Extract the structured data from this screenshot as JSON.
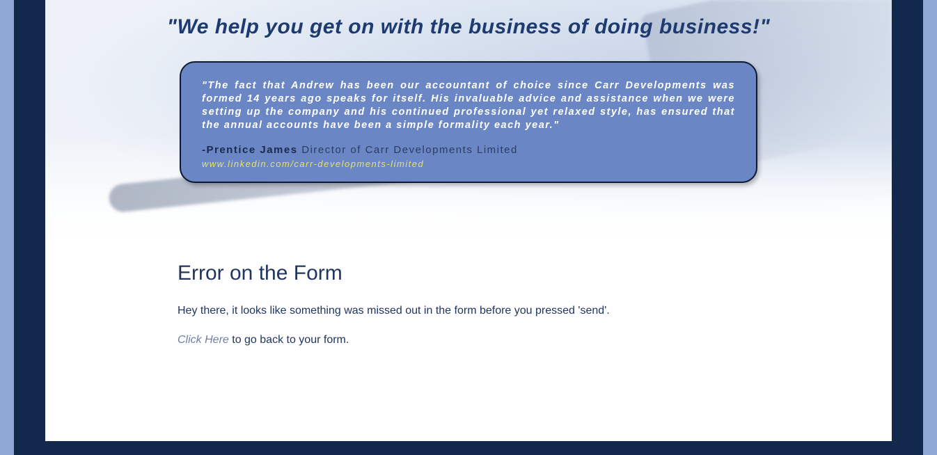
{
  "hero": {
    "tagline": "\"We help you get on with the business of doing business!\""
  },
  "testimonial": {
    "quote": "\"The fact that Andrew has been our accountant of choice since Carr Developments was formed 14 years ago speaks for itself. His invaluable advice and assistance when we were setting up the company and his continued professional yet relaxed style, has ensured that the annual accounts have been a simple formality each year.\"",
    "author_prefix": "-",
    "author_name": "Prentice James",
    "author_role": "Director of Carr Developments Limited",
    "link_text": "www.linkedin.com/carr-developments-limited"
  },
  "error": {
    "heading": "Error on the Form",
    "body": "Hey there, it looks like something was missed out in the form before you pressed 'send'.",
    "back_link_text": "Click Here",
    "back_suffix": " to go back to your form."
  }
}
